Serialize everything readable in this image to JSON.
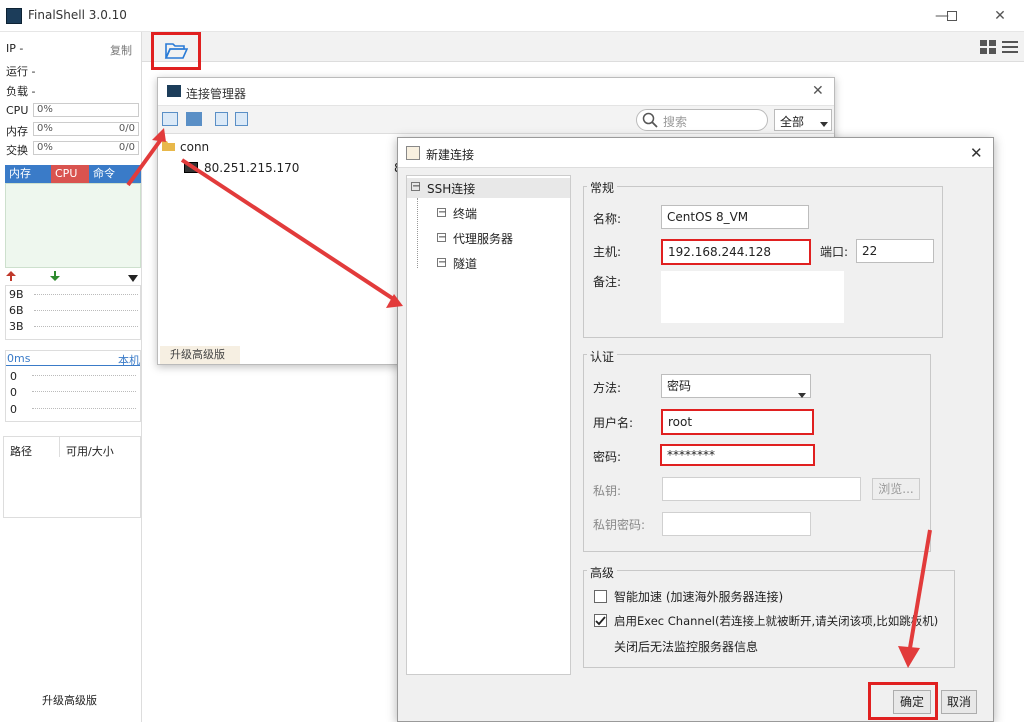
{
  "app": {
    "title": "FinalShell 3.0.10"
  },
  "sidebar": {
    "ip_label": "IP  -",
    "copy_label": "复制",
    "uptime_label": "运行 -",
    "load_label": "负载 -",
    "cpu_label": "CPU",
    "cpu_value": "0%",
    "mem_label": "内存",
    "mem_value": "0%",
    "mem_ratio": "0/0",
    "swap_label": "交换",
    "swap_value": "0%",
    "swap_ratio": "0/0",
    "tabs": [
      "内存",
      "CPU",
      "命令"
    ],
    "net_ticks": [
      "9B",
      "6B",
      "3B"
    ],
    "latency_label": "0ms",
    "latency_host": "本机",
    "latency_ticks": [
      "0",
      "0",
      "0"
    ],
    "disk_cols": [
      "路径",
      "可用/大小"
    ],
    "upgrade": "升级高级版"
  },
  "conn_manager": {
    "title": "连接管理器",
    "search_placeholder": "搜索",
    "filter_value": "全部",
    "folder": "conn",
    "host_entry": "80.251.215.170",
    "host_suffix": "8",
    "upgrade": "升级高级版"
  },
  "dialog": {
    "title": "新建连接",
    "tree": {
      "root": "SSH连接",
      "children": [
        "终端",
        "代理服务器",
        "隧道"
      ]
    },
    "general": {
      "legend": "常规",
      "name_label": "名称:",
      "name_value": "CentOS 8_VM",
      "host_label": "主机:",
      "host_value": "192.168.244.128",
      "port_label": "端口:",
      "port_value": "22",
      "note_label": "备注:"
    },
    "auth": {
      "legend": "认证",
      "method_label": "方法:",
      "method_value": "密码",
      "user_label": "用户名:",
      "user_value": "root",
      "password_label": "密码:",
      "password_value": "********",
      "key_label": "私钥:",
      "browse": "浏览...",
      "key_pass_label": "私钥密码:"
    },
    "advanced": {
      "legend": "高级",
      "smart_accel": "智能加速 (加速海外服务器连接)",
      "smart_accel_checked": false,
      "exec_channel": "启用Exec Channel(若连接上就被断开,请关闭该项,比如跳板机)",
      "exec_channel_checked": true,
      "exec_note": "关闭后无法监控服务器信息"
    },
    "ok": "确定",
    "cancel": "取消"
  },
  "colors": {
    "annotation_red": "#e02020",
    "tab_blue": "#3a7bc8",
    "tab_red": "#d9534f"
  }
}
